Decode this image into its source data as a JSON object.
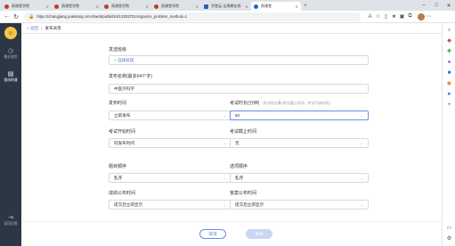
{
  "browser": {
    "tabs": [
      {
        "label": "雨课堂学院",
        "icon": "rain-classroom-icon",
        "active": false
      },
      {
        "label": "雨课堂学院",
        "icon": "rain-classroom-icon",
        "active": false
      },
      {
        "label": "雨课堂学院",
        "icon": "rain-classroom-icon",
        "active": false
      },
      {
        "label": "雨课堂学院",
        "icon": "rain-classroom-icon",
        "active": false
      },
      {
        "label": "学堂云-全周期在线",
        "icon": "xuetangyun-icon",
        "active": false
      },
      {
        "label": "雨课堂",
        "icon": "rain-classroom-icon",
        "active": true
      }
    ],
    "url": "https://changjiang.yuketang.cn/v2/web/publish/3/13253701/organize_problem_method=1"
  },
  "sidebar": {
    "items": [
      {
        "label": "最近使用",
        "icon": "clock-icon"
      },
      {
        "label": "我听的课",
        "icon": "book-icon"
      },
      {
        "label": "返回旧版",
        "icon": "exit-icon"
      }
    ]
  },
  "header": {
    "back_label": "< 返回",
    "title": "发布试卷"
  },
  "form": {
    "send_class_label": "发送班级",
    "send_class_action": "+ 选择班级",
    "publish_name_label": "发布名称(最多64个字)",
    "publish_name_value": "中医外科学",
    "publish_time_label": "发布时间",
    "publish_time_value": "立即发布",
    "duration_label": "考试时长(分钟)",
    "duration_hint": "(考试时长需≤考试截止时间 - 考试开始时间)",
    "duration_value": "60",
    "start_time_label": "考试开始时间",
    "start_time_value": "同发布时间",
    "end_time_label": "考试截止时间",
    "end_time_value": "无",
    "question_order_label": "题目顺序",
    "question_order_value": "乱序",
    "option_order_label": "选项顺序",
    "option_order_value": "乱序",
    "score_release_label": "成绩公布时间",
    "score_release_value": "提交后立即显示",
    "answer_release_label": "答案公布时间",
    "answer_release_value": "提交后立即显示"
  },
  "footer": {
    "cancel_label": "取消",
    "publish_label": "发布"
  },
  "colors": {
    "sidebar_bg": "#2d3645",
    "accent": "#5b7bd5",
    "publish_disabled": "#c9d6f3"
  }
}
